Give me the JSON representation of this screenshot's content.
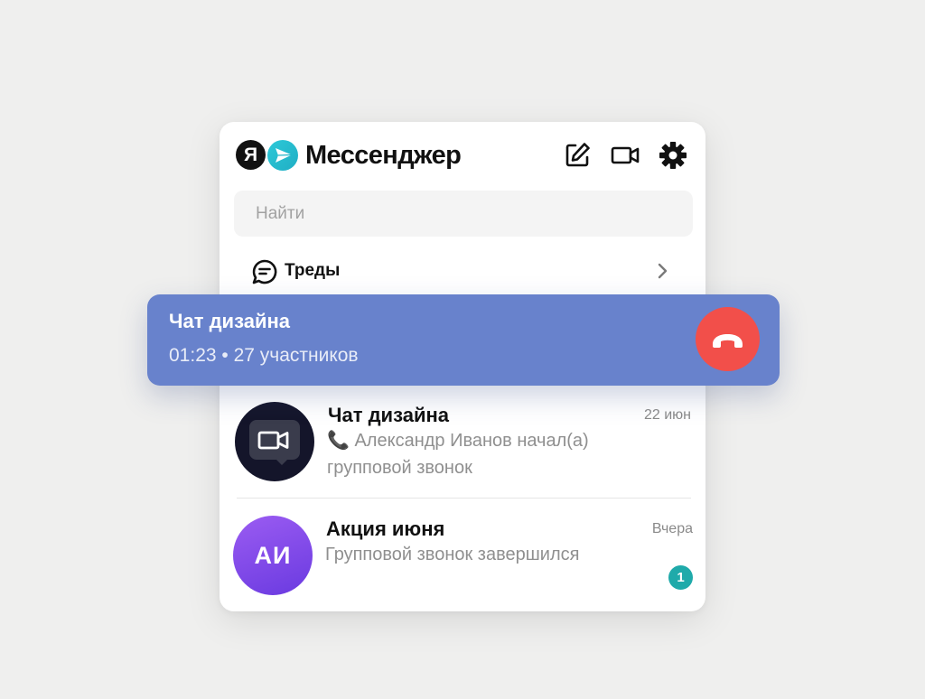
{
  "app": {
    "title": "Мессенджер",
    "logo_letter": "Я"
  },
  "header": {
    "icons": [
      "compose-icon",
      "video-call-icon",
      "gear-icon"
    ]
  },
  "search": {
    "placeholder": "Найти"
  },
  "threads": {
    "label": "Треды",
    "icon": "threads-icon"
  },
  "active_call": {
    "title": "Чат дизайна",
    "status": "01:23 • 27 участников",
    "hangup_color": "#f24f4a",
    "banner_color": "#6882cc"
  },
  "chats": [
    {
      "name": "Чат дизайна",
      "date": "22 июн",
      "preview_line1": "📞 Александр Иванов начал(а)",
      "preview_line2": "групповой звонок",
      "avatar_icon": "video-call-icon"
    },
    {
      "name": "Акция июня",
      "date": "Вчера",
      "preview": "Групповой звонок завершился",
      "avatar_initials": "АИ",
      "unread": "1"
    }
  ]
}
